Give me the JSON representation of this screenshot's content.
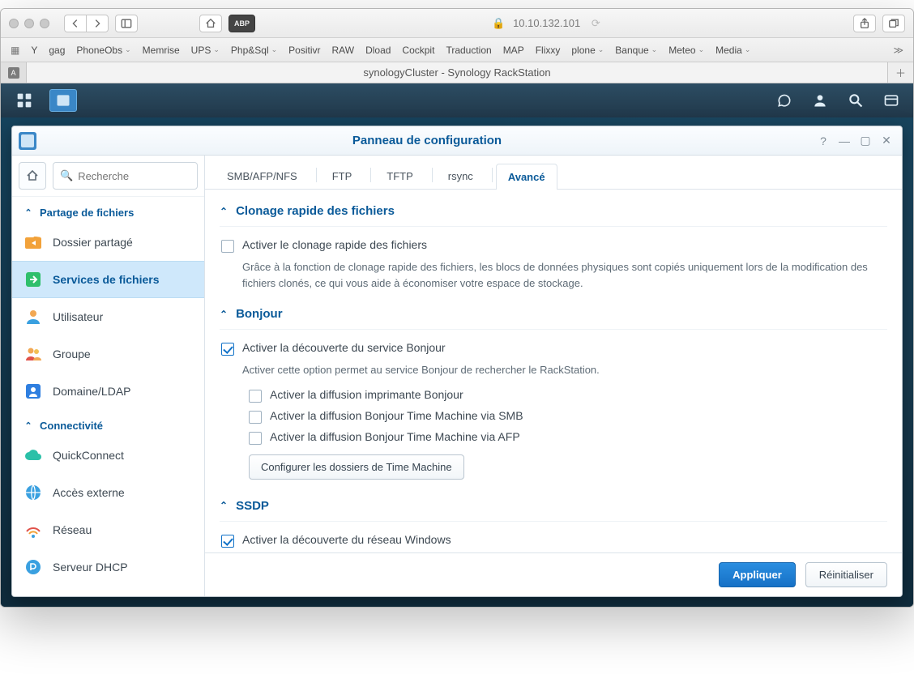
{
  "browser": {
    "url": "10.10.132.101",
    "bookmarks": [
      "Y",
      "gag",
      "PhoneObs",
      "Memrise",
      "UPS",
      "Php&Sql",
      "Positivr",
      "RAW",
      "Dload",
      "Cockpit",
      "Traduction",
      "MAP",
      "Flixxy",
      "plone",
      "Banque",
      "Meteo",
      "Media"
    ],
    "bookmark_dropdown_indices": [
      2,
      4,
      5,
      13,
      14,
      15,
      16
    ],
    "tab_title": "synologyCluster - Synology RackStation",
    "tab_badge": "A"
  },
  "cpwin": {
    "title": "Panneau de configuration",
    "search_placeholder": "Recherche",
    "sections": {
      "file_sharing": {
        "label": "Partage de fichiers"
      },
      "connectivity": {
        "label": "Connectivité"
      }
    },
    "side_items": {
      "shared_folder": "Dossier partagé",
      "file_services": "Services de fichiers",
      "user": "Utilisateur",
      "group": "Groupe",
      "domain_ldap": "Domaine/LDAP",
      "quickconnect": "QuickConnect",
      "external_access": "Accès externe",
      "network": "Réseau",
      "dhcp_server": "Serveur DHCP"
    },
    "tabs": {
      "smb": "SMB/AFP/NFS",
      "ftp": "FTP",
      "tftp": "TFTP",
      "rsync": "rsync",
      "advanced": "Avancé"
    },
    "sections_main": {
      "fast_clone": {
        "title": "Clonage rapide des fichiers",
        "enable": "Activer le clonage rapide des fichiers",
        "hint": "Grâce à la fonction de clonage rapide des fichiers, les blocs de données physiques sont copiés uniquement lors de la modification des fichiers clonés, ce qui vous aide à économiser votre espace de stockage."
      },
      "bonjour": {
        "title": "Bonjour",
        "enable": "Activer la découverte du service Bonjour",
        "hint": "Activer cette option permet au service Bonjour de rechercher le RackStation.",
        "printer": "Activer la diffusion imprimante Bonjour",
        "tm_smb": "Activer la diffusion Bonjour Time Machine via SMB",
        "tm_afp": "Activer la diffusion Bonjour Time Machine via AFP",
        "configure_tm": "Configurer les dossiers de Time Machine"
      },
      "ssdp": {
        "title": "SSDP",
        "enable": "Activer la découverte du réseau Windows"
      }
    },
    "buttons": {
      "apply": "Appliquer",
      "reset": "Réinitialiser"
    }
  }
}
